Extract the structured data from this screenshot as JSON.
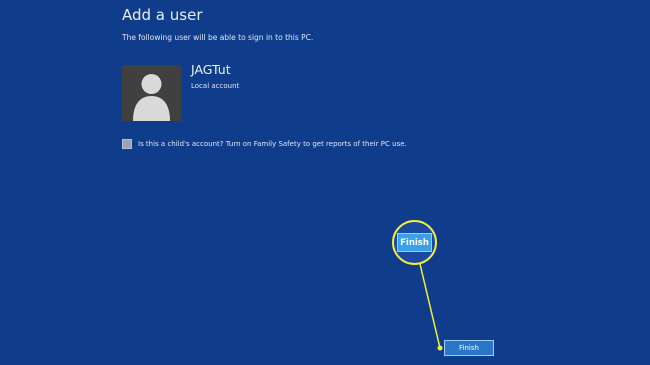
{
  "header": {
    "title": "Add a user",
    "subtitle": "The following user will be able to sign in to this PC."
  },
  "user": {
    "name": "JAGTut",
    "account_type": "Local account"
  },
  "family_safety": {
    "label": "Is this a child's account? Turn on Family Safety to get reports of their PC use.",
    "checked": false
  },
  "callout": {
    "label": "Finish",
    "color": "#f6ee3a"
  },
  "footer": {
    "finish_label": "Finish"
  },
  "colors": {
    "background": "#0f3d8c",
    "button": "#2a77c9"
  },
  "icons": {
    "avatar": "user-silhouette-icon"
  }
}
